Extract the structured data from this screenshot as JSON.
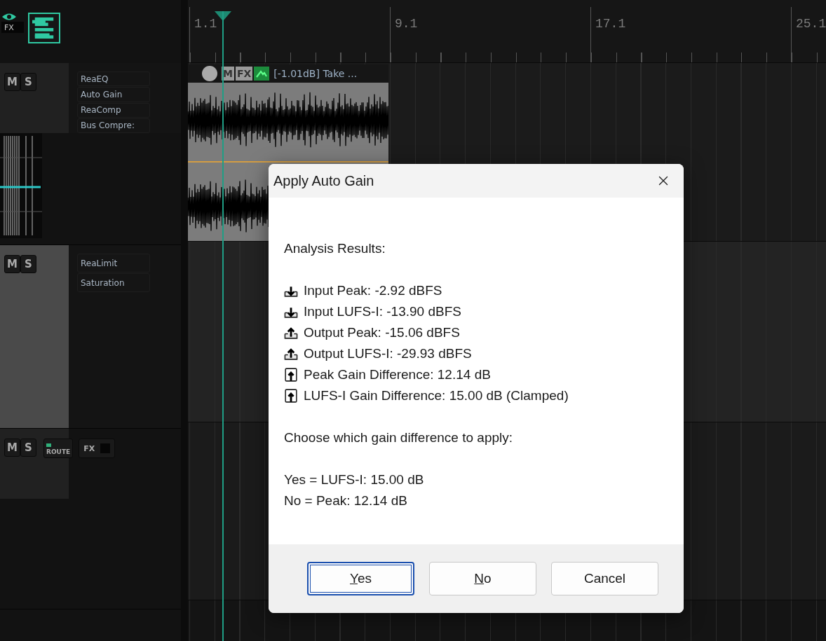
{
  "header": {
    "fx_label": "FX"
  },
  "ruler": {
    "marks": [
      "1.1",
      "9.1",
      "17.1",
      "25.1"
    ]
  },
  "tracks": [
    {
      "kind": "meter",
      "mute_label": "M",
      "solo_label": "S",
      "fx_chain": [
        "ReaEQ",
        "Auto Gain",
        "ReaComp",
        "Bus Compre:"
      ]
    },
    {
      "kind": "panel",
      "mute_label": "M",
      "solo_label": "S",
      "fx_chain": [
        "ReaLimit",
        "Saturation"
      ]
    },
    {
      "kind": "routing",
      "mute_label": "M",
      "solo_label": "S",
      "route_label": "ROUTE",
      "fx_label": "FX"
    }
  ],
  "item": {
    "mute_label": "M",
    "fx_label": "FX",
    "take_label": "[-1.01dB] Take ..."
  },
  "dialog": {
    "title": "Apply Auto Gain",
    "heading": "Analysis Results:",
    "results": [
      {
        "kind": "input",
        "text": "Input Peak: -2.92 dBFS"
      },
      {
        "kind": "input",
        "text": "Input LUFS-I: -13.90 dBFS"
      },
      {
        "kind": "output",
        "text": "Output Peak: -15.06 dBFS"
      },
      {
        "kind": "output",
        "text": "Output LUFS-I: -29.93 dBFS"
      },
      {
        "kind": "difference",
        "text": "Peak Gain Difference: 12.14 dB"
      },
      {
        "kind": "difference",
        "text": "LUFS-I Gain Difference: 15.00 dB (Clamped)"
      }
    ],
    "prompt": "Choose which gain difference to apply:",
    "choices": [
      "Yes = LUFS-I: 15.00 dB",
      "No = Peak: 12.14 dB"
    ],
    "buttons": [
      {
        "access_key": "Y",
        "label_rest": "es",
        "focused": true
      },
      {
        "access_key": "N",
        "label_rest": "o",
        "focused": false
      },
      {
        "label": "Cancel",
        "focused": false
      }
    ]
  }
}
